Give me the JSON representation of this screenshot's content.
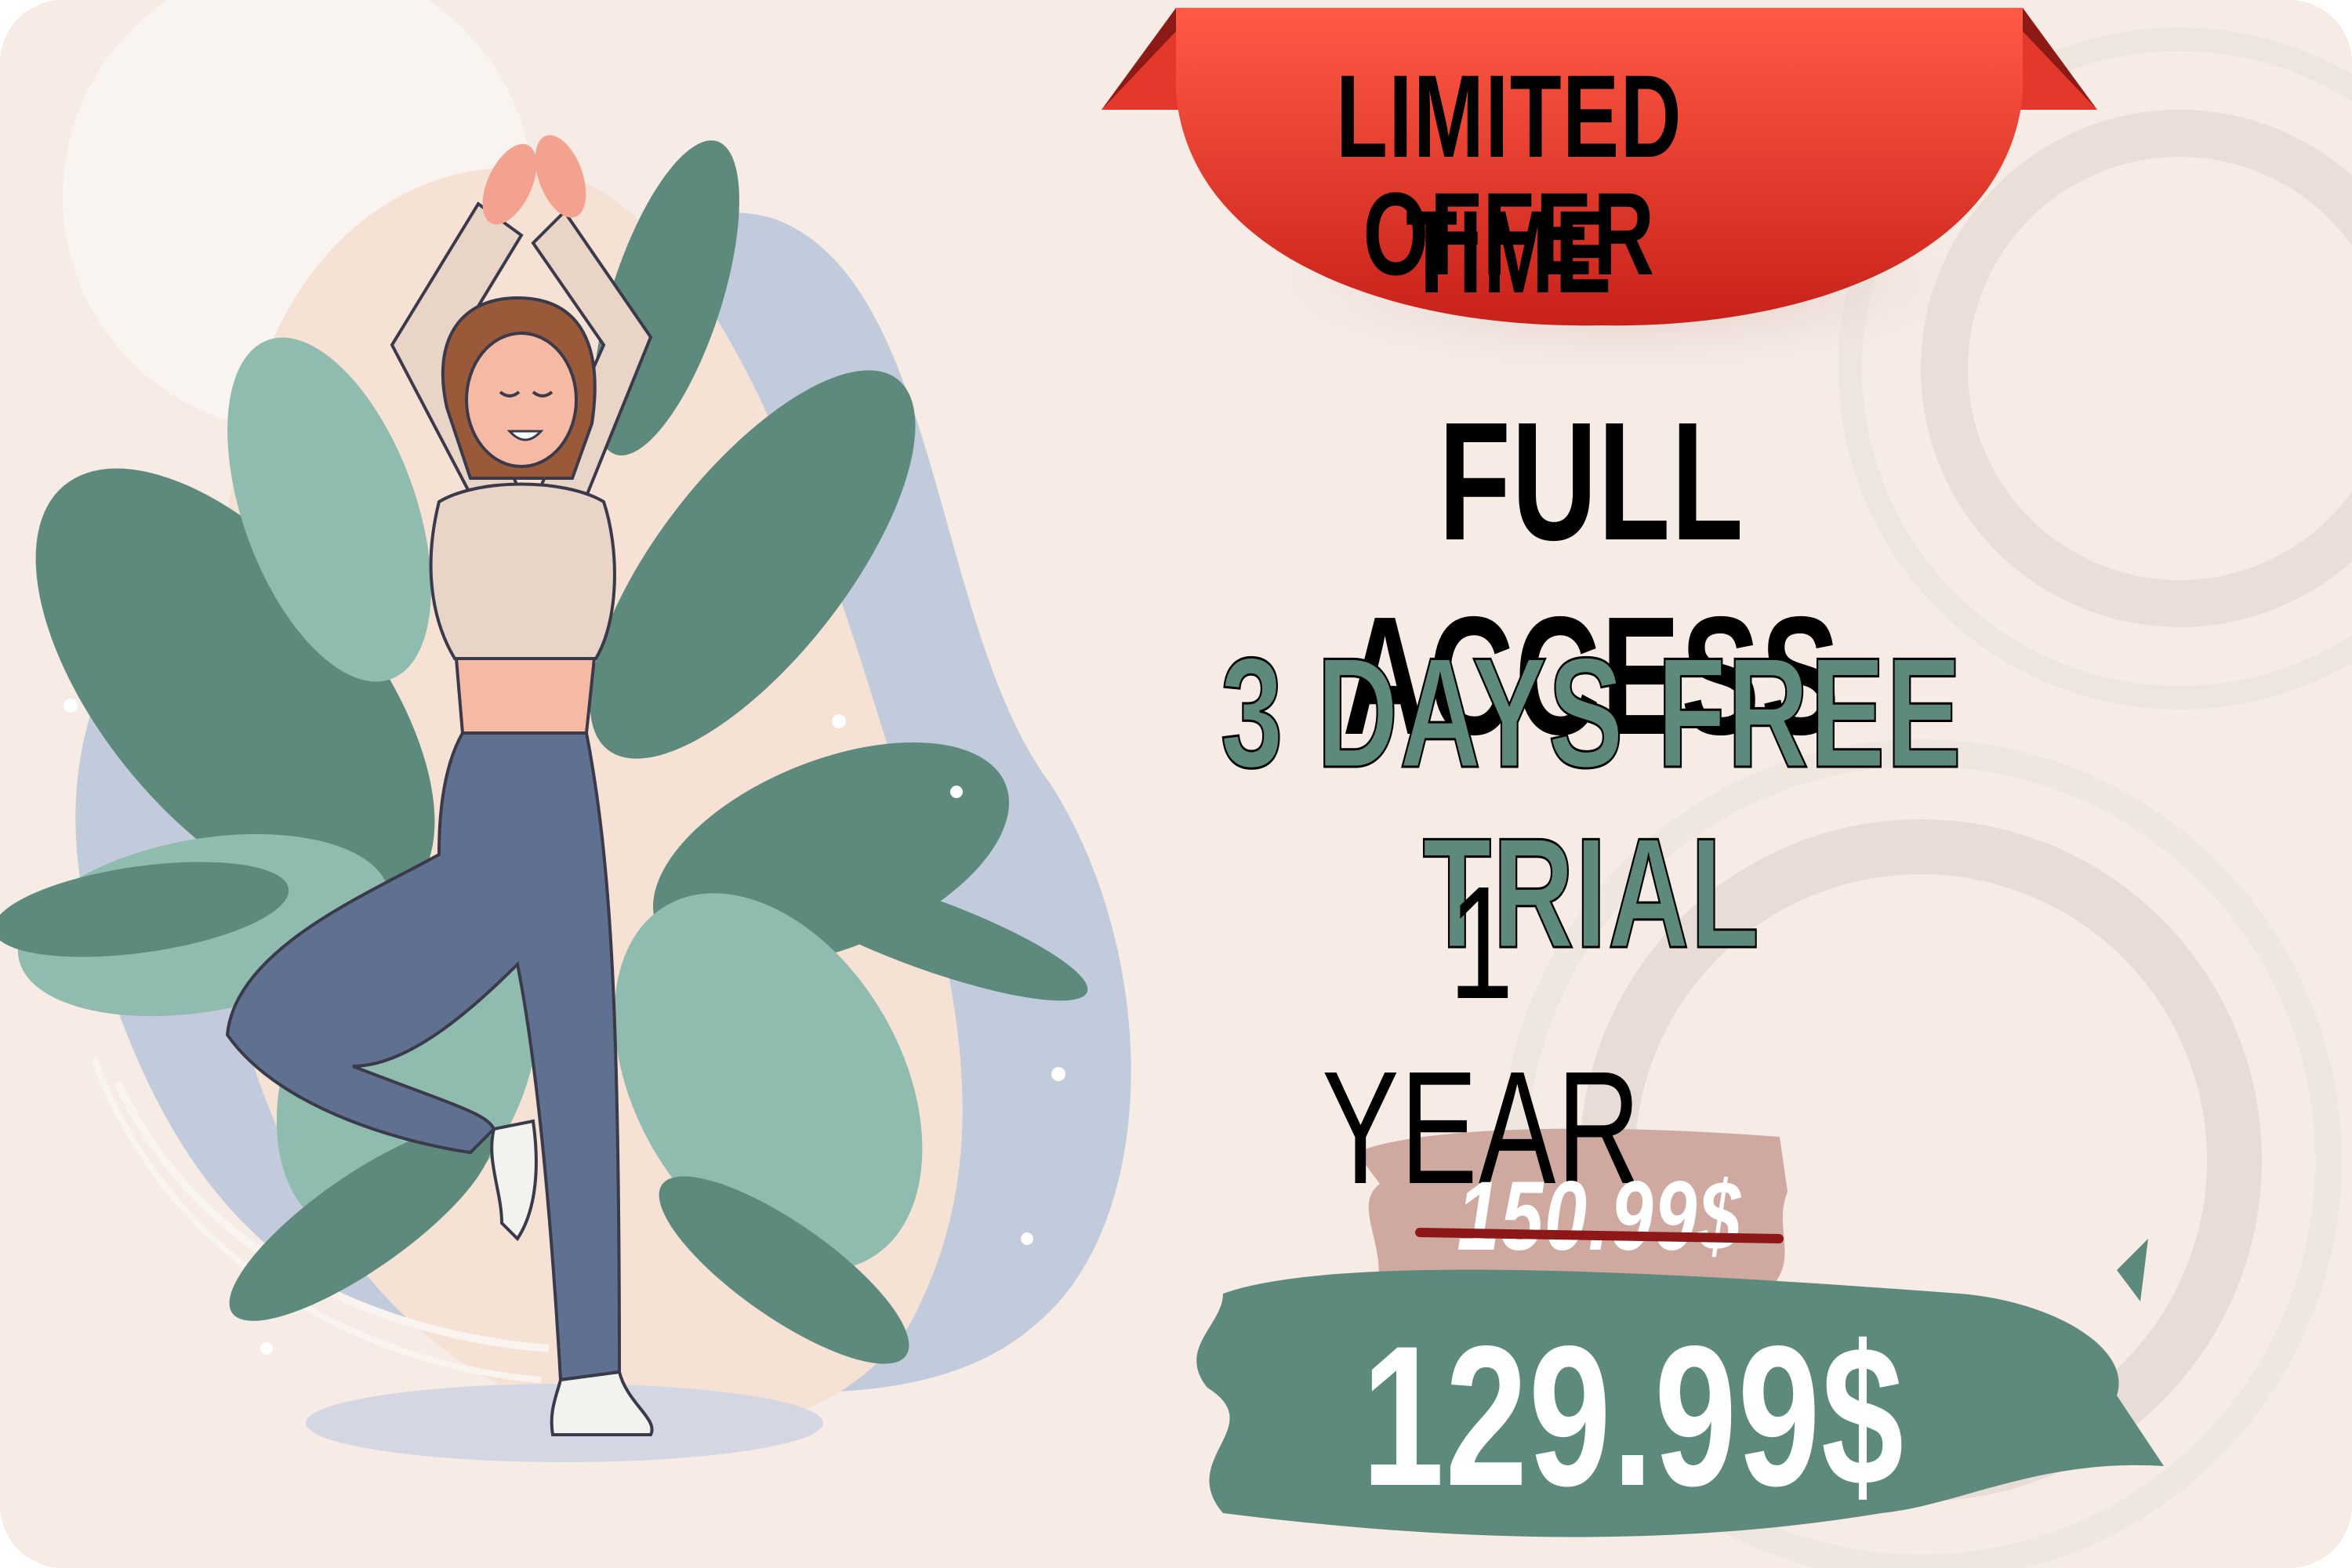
{
  "banner": {
    "line1": "LIMITED TIME",
    "line2": "OFFER",
    "color": "#e43a2e"
  },
  "offer": {
    "title": "FULL ACCESS",
    "trial": "3 DAYS FREE TRIAL",
    "duration": "1 YEAR",
    "trial_color": "#5d8a7d"
  },
  "pricing": {
    "old_price": "150.99$",
    "new_price": "129.99$",
    "old_brush_color": "#cfa9a0",
    "new_brush_color": "#5d8a7d"
  },
  "illustration": {
    "subject": "woman-yoga-tree-pose-icon",
    "palette": [
      "#5d8a7d",
      "#8fbcaf",
      "#c2cbdc",
      "#5f7090",
      "#e9d4c8"
    ]
  }
}
